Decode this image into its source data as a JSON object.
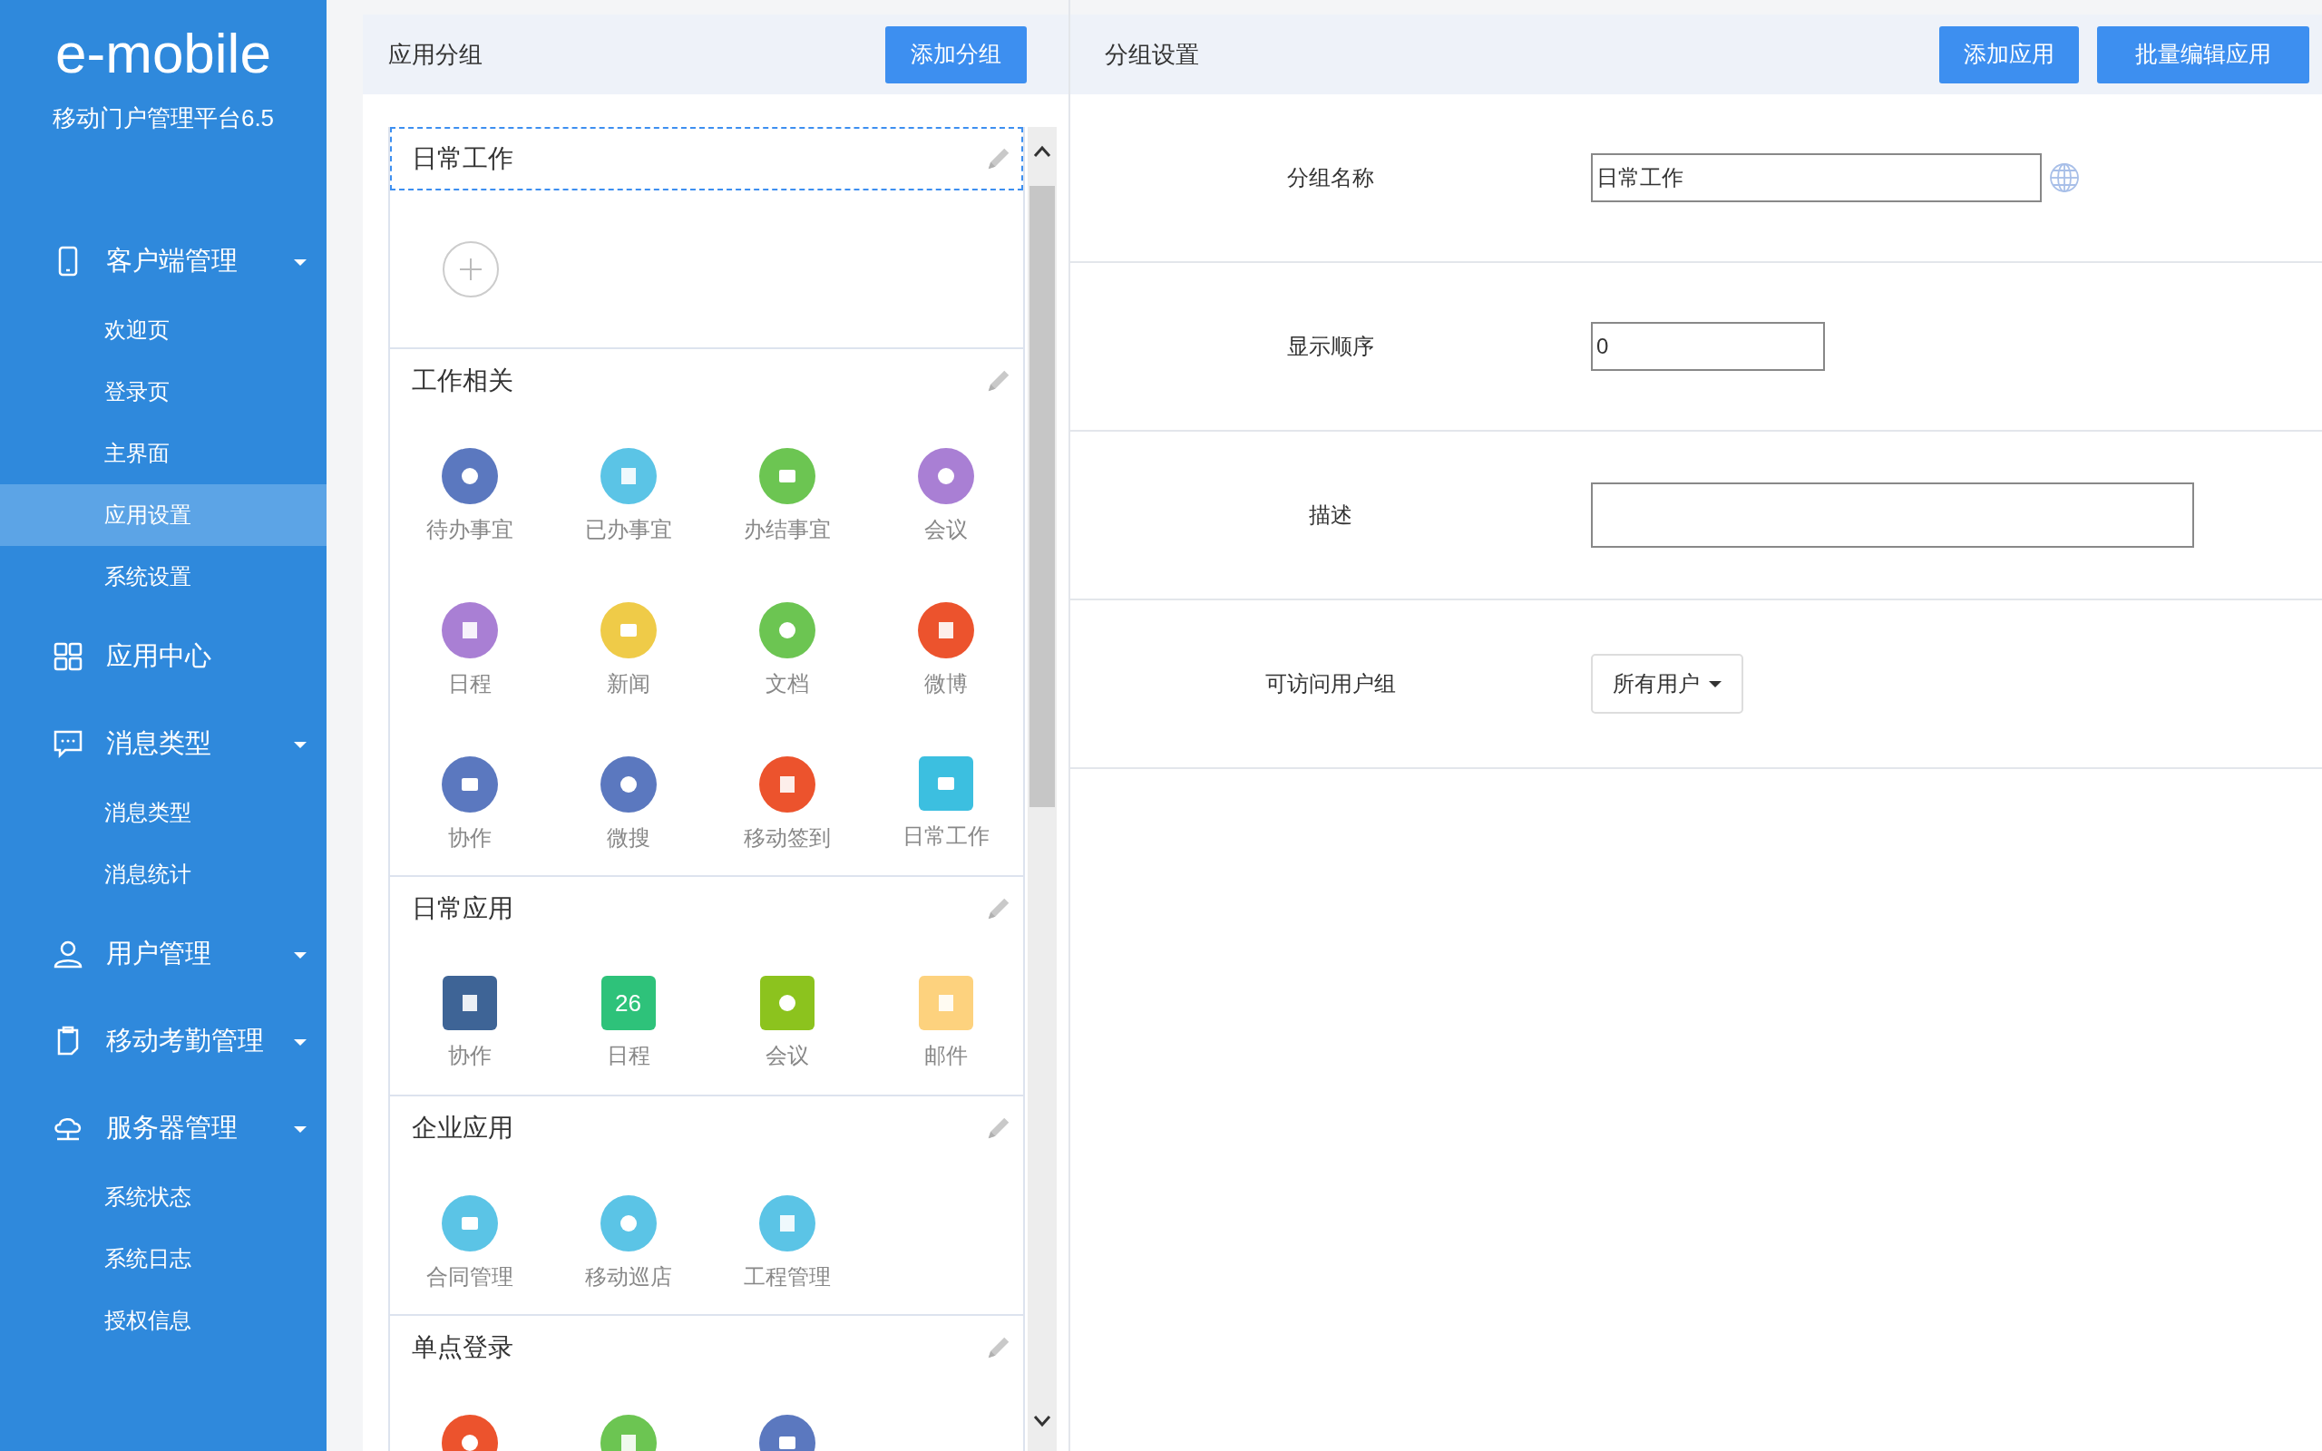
{
  "sidebar": {
    "logo": "e-mobile",
    "subtitle": "移动门户管理平台6.5",
    "items": [
      {
        "label": "客户端管理",
        "kind": "group",
        "children": [
          {
            "label": "欢迎页",
            "selected": false
          },
          {
            "label": "登录页",
            "selected": false
          },
          {
            "label": "主界面",
            "selected": false
          },
          {
            "label": "应用设置",
            "selected": true
          },
          {
            "label": "系统设置",
            "selected": false
          }
        ]
      },
      {
        "label": "应用中心",
        "kind": "link"
      },
      {
        "label": "消息类型",
        "kind": "group",
        "children": [
          {
            "label": "消息类型",
            "selected": false
          },
          {
            "label": "消息统计",
            "selected": false
          }
        ]
      },
      {
        "label": "用户管理",
        "kind": "group"
      },
      {
        "label": "移动考勤管理",
        "kind": "group"
      },
      {
        "label": "服务器管理",
        "kind": "group",
        "children": [
          {
            "label": "系统状态",
            "selected": false
          },
          {
            "label": "系统日志",
            "selected": false
          },
          {
            "label": "授权信息",
            "selected": false
          }
        ]
      }
    ]
  },
  "groups_panel": {
    "title": "应用分组",
    "button": "添加分组",
    "groups": [
      {
        "title": "日常工作",
        "selected": true
      },
      {
        "title": "工作相关",
        "selected": false,
        "apps": [
          {
            "label": "待办事宜",
            "kind": "circle",
            "color": "#5b78bf"
          },
          {
            "label": "已办事宜",
            "kind": "circle",
            "color": "#5bc4e6"
          },
          {
            "label": "办结事宜",
            "kind": "circle",
            "color": "#6cc552"
          },
          {
            "label": "会议",
            "kind": "circle",
            "color": "#a97fd4"
          },
          {
            "label": "日程",
            "kind": "circle",
            "color": "#a97fd4"
          },
          {
            "label": "新闻",
            "kind": "circle",
            "color": "#efcb48"
          },
          {
            "label": "文档",
            "kind": "circle",
            "color": "#6cc552"
          },
          {
            "label": "微博",
            "kind": "circle",
            "color": "#ec532d"
          },
          {
            "label": "协作",
            "kind": "circle",
            "color": "#5b78bf"
          },
          {
            "label": "微搜",
            "kind": "circle",
            "color": "#5b78bf"
          },
          {
            "label": "移动签到",
            "kind": "circle",
            "color": "#ec532d"
          },
          {
            "label": "日常工作",
            "kind": "square",
            "color": "#3cbfe0"
          }
        ]
      },
      {
        "title": "日常应用",
        "selected": false,
        "apps": [
          {
            "label": "协作",
            "kind": "square",
            "color": "#3e6496"
          },
          {
            "label": "日程",
            "kind": "square",
            "color": "#2ec27a",
            "icon_text": "26"
          },
          {
            "label": "会议",
            "kind": "square",
            "color": "#8cc31e"
          },
          {
            "label": "邮件",
            "kind": "square",
            "color": "#fdd27e"
          }
        ]
      },
      {
        "title": "企业应用",
        "selected": false,
        "apps": [
          {
            "label": "合同管理",
            "kind": "circle",
            "color": "#5bc4e6"
          },
          {
            "label": "移动巡店",
            "kind": "circle",
            "color": "#5bc4e6"
          },
          {
            "label": "工程管理",
            "kind": "circle",
            "color": "#5bc4e6"
          }
        ]
      },
      {
        "title": "单点登录",
        "selected": false,
        "apps": [
          {
            "kind": "circle",
            "color": "#ec532d"
          },
          {
            "kind": "circle",
            "color": "#6cc552"
          },
          {
            "kind": "circle",
            "color": "#5b78bf"
          }
        ]
      }
    ]
  },
  "settings_panel": {
    "title": "分组设置",
    "buttons": [
      "添加应用",
      "批量编辑应用"
    ],
    "fields": [
      {
        "label": "分组名称",
        "kind": "text",
        "value": "日常工作",
        "translatable": true
      },
      {
        "label": "显示顺序",
        "kind": "number",
        "value": "0",
        "translatable": false
      },
      {
        "label": "描述",
        "kind": "textarea",
        "translatable": false
      },
      {
        "label": "可访问用户组",
        "kind": "select",
        "value": "所有用户",
        "translatable": false
      }
    ]
  }
}
